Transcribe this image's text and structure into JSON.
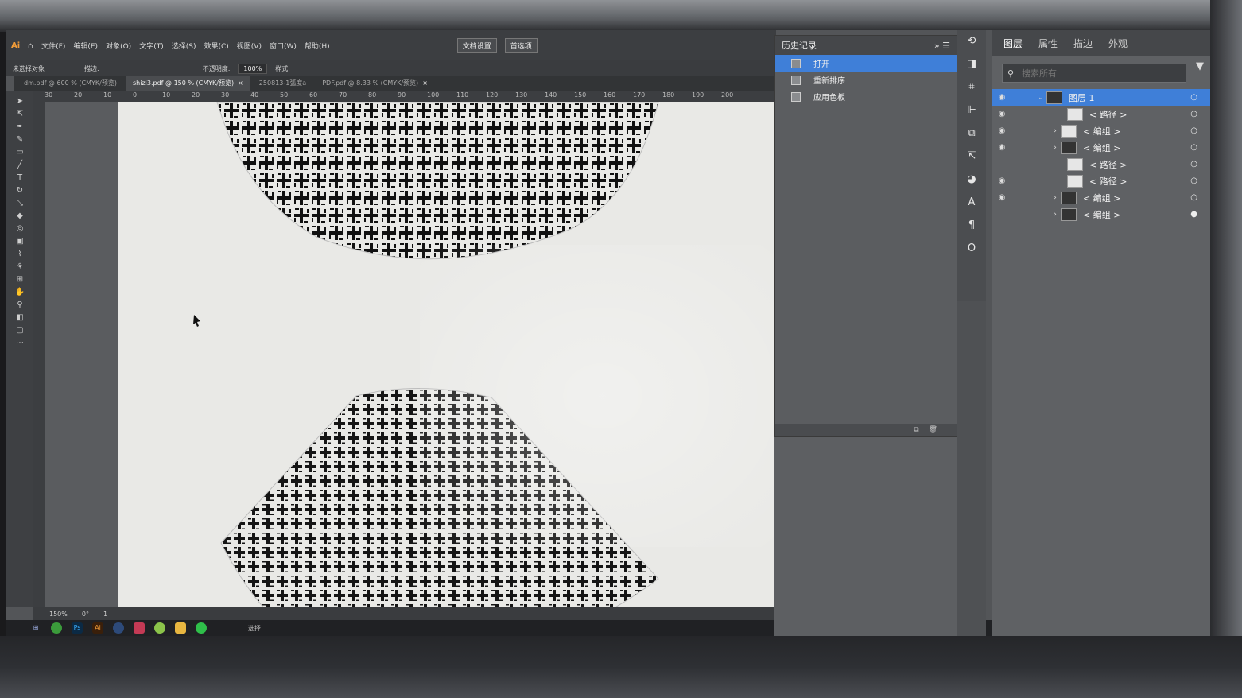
{
  "app": {
    "logo": "Ai",
    "home_icon": "home-icon"
  },
  "menu": [
    "文件(F)",
    "编辑(E)",
    "对象(O)",
    "文字(T)",
    "选择(S)",
    "效果(C)",
    "视图(V)",
    "窗口(W)",
    "帮助(H)"
  ],
  "toolbar_top": {
    "doc_setup": "文档设置",
    "prefs": "首选项"
  },
  "control_bar": {
    "selection": "未选择对象",
    "stroke_label": "描边:",
    "opacity_label": "不透明度:",
    "opacity_value": "100%",
    "style_label": "样式:"
  },
  "tabs": [
    {
      "label": "dm.pdf @ 600 % (CMYK/预览)",
      "active": false
    },
    {
      "label": "shizi3.pdf @ 150 % (CMYK/预览)",
      "active": true
    },
    {
      "label": "250813-1弧度a",
      "active": false
    },
    {
      "label": "PDF.pdf @ 8.33 % (CMYK/预览)",
      "active": false
    }
  ],
  "ruler_ticks": [
    "30",
    "20",
    "10",
    "0",
    "10",
    "20",
    "30",
    "40",
    "50",
    "60",
    "70",
    "80",
    "90",
    "100",
    "110",
    "120",
    "130",
    "140",
    "150",
    "160",
    "170",
    "180",
    "190",
    "200"
  ],
  "status": {
    "zoom": "150%",
    "angle": "0°",
    "page": "1",
    "tool": "选择"
  },
  "history": {
    "title": "历史记录",
    "items": [
      {
        "label": "打开",
        "selected": true
      },
      {
        "label": "重新排序",
        "selected": false
      },
      {
        "label": "应用色板",
        "selected": false
      }
    ]
  },
  "layers": {
    "tabs": [
      "图层",
      "属性",
      "描边",
      "外观"
    ],
    "search_placeholder": "搜索所有",
    "rows": [
      {
        "name": "图层 1",
        "selected": true
      },
      {
        "name": "< 路径 >",
        "selected": false
      },
      {
        "name": "< 编组 >",
        "selected": false
      },
      {
        "name": "< 编组 >",
        "selected": false
      },
      {
        "name": "< 路径 >",
        "selected": false
      },
      {
        "name": "< 路径 >",
        "selected": false
      },
      {
        "name": "< 编组 >",
        "selected": false
      },
      {
        "name": "< 编组 >",
        "selected": false
      }
    ]
  },
  "colors": {
    "selection_blue": "#3f7fd8",
    "ai_orange": "#f29c38"
  }
}
